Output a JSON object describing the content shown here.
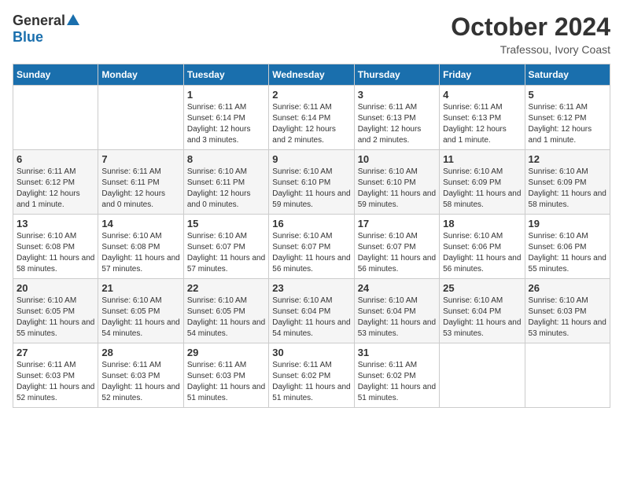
{
  "header": {
    "logo_general": "General",
    "logo_blue": "Blue",
    "month_title": "October 2024",
    "location": "Trafessou, Ivory Coast"
  },
  "weekdays": [
    "Sunday",
    "Monday",
    "Tuesday",
    "Wednesday",
    "Thursday",
    "Friday",
    "Saturday"
  ],
  "weeks": [
    [
      {
        "day": "",
        "detail": ""
      },
      {
        "day": "",
        "detail": ""
      },
      {
        "day": "1",
        "detail": "Sunrise: 6:11 AM\nSunset: 6:14 PM\nDaylight: 12 hours\nand 3 minutes."
      },
      {
        "day": "2",
        "detail": "Sunrise: 6:11 AM\nSunset: 6:14 PM\nDaylight: 12 hours\nand 2 minutes."
      },
      {
        "day": "3",
        "detail": "Sunrise: 6:11 AM\nSunset: 6:13 PM\nDaylight: 12 hours\nand 2 minutes."
      },
      {
        "day": "4",
        "detail": "Sunrise: 6:11 AM\nSunset: 6:13 PM\nDaylight: 12 hours\nand 1 minute."
      },
      {
        "day": "5",
        "detail": "Sunrise: 6:11 AM\nSunset: 6:12 PM\nDaylight: 12 hours\nand 1 minute."
      }
    ],
    [
      {
        "day": "6",
        "detail": "Sunrise: 6:11 AM\nSunset: 6:12 PM\nDaylight: 12 hours\nand 1 minute."
      },
      {
        "day": "7",
        "detail": "Sunrise: 6:11 AM\nSunset: 6:11 PM\nDaylight: 12 hours\nand 0 minutes."
      },
      {
        "day": "8",
        "detail": "Sunrise: 6:10 AM\nSunset: 6:11 PM\nDaylight: 12 hours\nand 0 minutes."
      },
      {
        "day": "9",
        "detail": "Sunrise: 6:10 AM\nSunset: 6:10 PM\nDaylight: 11 hours\nand 59 minutes."
      },
      {
        "day": "10",
        "detail": "Sunrise: 6:10 AM\nSunset: 6:10 PM\nDaylight: 11 hours\nand 59 minutes."
      },
      {
        "day": "11",
        "detail": "Sunrise: 6:10 AM\nSunset: 6:09 PM\nDaylight: 11 hours\nand 58 minutes."
      },
      {
        "day": "12",
        "detail": "Sunrise: 6:10 AM\nSunset: 6:09 PM\nDaylight: 11 hours\nand 58 minutes."
      }
    ],
    [
      {
        "day": "13",
        "detail": "Sunrise: 6:10 AM\nSunset: 6:08 PM\nDaylight: 11 hours\nand 58 minutes."
      },
      {
        "day": "14",
        "detail": "Sunrise: 6:10 AM\nSunset: 6:08 PM\nDaylight: 11 hours\nand 57 minutes."
      },
      {
        "day": "15",
        "detail": "Sunrise: 6:10 AM\nSunset: 6:07 PM\nDaylight: 11 hours\nand 57 minutes."
      },
      {
        "day": "16",
        "detail": "Sunrise: 6:10 AM\nSunset: 6:07 PM\nDaylight: 11 hours\nand 56 minutes."
      },
      {
        "day": "17",
        "detail": "Sunrise: 6:10 AM\nSunset: 6:07 PM\nDaylight: 11 hours\nand 56 minutes."
      },
      {
        "day": "18",
        "detail": "Sunrise: 6:10 AM\nSunset: 6:06 PM\nDaylight: 11 hours\nand 56 minutes."
      },
      {
        "day": "19",
        "detail": "Sunrise: 6:10 AM\nSunset: 6:06 PM\nDaylight: 11 hours\nand 55 minutes."
      }
    ],
    [
      {
        "day": "20",
        "detail": "Sunrise: 6:10 AM\nSunset: 6:05 PM\nDaylight: 11 hours\nand 55 minutes."
      },
      {
        "day": "21",
        "detail": "Sunrise: 6:10 AM\nSunset: 6:05 PM\nDaylight: 11 hours\nand 54 minutes."
      },
      {
        "day": "22",
        "detail": "Sunrise: 6:10 AM\nSunset: 6:05 PM\nDaylight: 11 hours\nand 54 minutes."
      },
      {
        "day": "23",
        "detail": "Sunrise: 6:10 AM\nSunset: 6:04 PM\nDaylight: 11 hours\nand 54 minutes."
      },
      {
        "day": "24",
        "detail": "Sunrise: 6:10 AM\nSunset: 6:04 PM\nDaylight: 11 hours\nand 53 minutes."
      },
      {
        "day": "25",
        "detail": "Sunrise: 6:10 AM\nSunset: 6:04 PM\nDaylight: 11 hours\nand 53 minutes."
      },
      {
        "day": "26",
        "detail": "Sunrise: 6:10 AM\nSunset: 6:03 PM\nDaylight: 11 hours\nand 53 minutes."
      }
    ],
    [
      {
        "day": "27",
        "detail": "Sunrise: 6:11 AM\nSunset: 6:03 PM\nDaylight: 11 hours\nand 52 minutes."
      },
      {
        "day": "28",
        "detail": "Sunrise: 6:11 AM\nSunset: 6:03 PM\nDaylight: 11 hours\nand 52 minutes."
      },
      {
        "day": "29",
        "detail": "Sunrise: 6:11 AM\nSunset: 6:03 PM\nDaylight: 11 hours\nand 51 minutes."
      },
      {
        "day": "30",
        "detail": "Sunrise: 6:11 AM\nSunset: 6:02 PM\nDaylight: 11 hours\nand 51 minutes."
      },
      {
        "day": "31",
        "detail": "Sunrise: 6:11 AM\nSunset: 6:02 PM\nDaylight: 11 hours\nand 51 minutes."
      },
      {
        "day": "",
        "detail": ""
      },
      {
        "day": "",
        "detail": ""
      }
    ]
  ]
}
